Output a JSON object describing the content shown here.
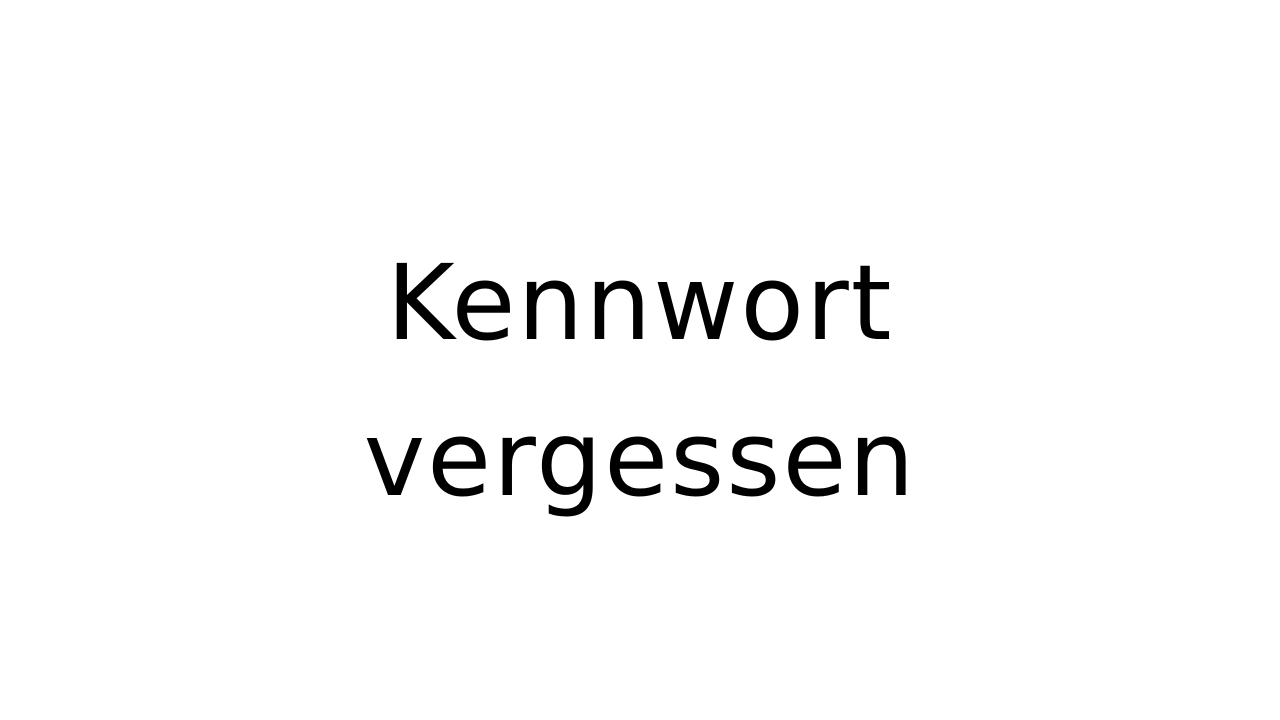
{
  "slide": {
    "title_lines": [
      "Kennwort",
      "vergessen"
    ],
    "background_color": "#ffffff",
    "text_color": "#000000"
  }
}
